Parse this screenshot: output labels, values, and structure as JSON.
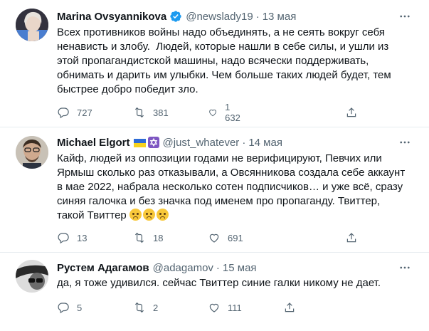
{
  "tweets": [
    {
      "name": "Marina Ovsyannikova",
      "handle": "@newslady19",
      "date": "13 мая",
      "text": "Всех противников войны надо объединять, а не сеять вокруг себя ненависть и злобу.  Людей, которые нашли в себе силы, и ушли из этой пропагандистской машины, надо всячески поддерживать, обнимать и дарить им улыбки. Чем больше таких людей будет, тем быстрее добро победит зло.",
      "replies": "727",
      "retweets": "381",
      "likes": "1 632"
    },
    {
      "name": "Michael Elgort",
      "handle": "@just_whatever",
      "date": "14 мая",
      "text": "Кайф, людей из оппозиции годами не верифицируют, Певчих или Ярмыш сколько раз отказывали, а Овсянникова создала себе аккаунт в мае 2022, набрала несколько сотен подписчиков… и уже всё, сразу синяя галочка и без значка под именем про пропаганду. Твиттер, такой Твиттер ",
      "replies": "13",
      "retweets": "18",
      "likes": "691"
    },
    {
      "name": "Рустем Адагамов",
      "handle": "@adagamov",
      "date": "15 мая",
      "text": "да, я тоже удивился. сейчас Твиттер синие галки никому не дает.",
      "replies": "5",
      "retweets": "2",
      "likes": "111"
    }
  ],
  "icons": [
    "verified-badge-icon",
    "ukraine-flag-icon",
    "star-of-david-icon",
    "reply-icon",
    "retweet-icon",
    "like-icon",
    "share-icon",
    "more-icon"
  ],
  "colors": {
    "verified": "#1d9bf0",
    "muted": "#536471",
    "separator": "#e6ecf0"
  }
}
